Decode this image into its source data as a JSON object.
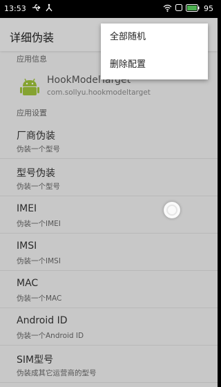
{
  "status_bar": {
    "time": "13:53",
    "battery": "95",
    "icons": [
      "usb-icon",
      "debug-icon",
      "wifi-icon",
      "sim-icon",
      "battery-icon"
    ]
  },
  "app_bar": {
    "title": "详细伪装"
  },
  "sections": {
    "app_info_header": "应用信息",
    "app_settings_header": "应用设置"
  },
  "app_info": {
    "name": "HookModelTarget",
    "package": "com.sollyu.hookmodeltarget",
    "icon": "android-icon"
  },
  "prefs": [
    {
      "title": "厂商伪装",
      "summary": "伪装一个型号"
    },
    {
      "title": "型号伪装",
      "summary": "伪装一个型号"
    },
    {
      "title": "IMEI",
      "summary": "伪装一个IMEI"
    },
    {
      "title": "IMSI",
      "summary": "伪装一个IMSI"
    },
    {
      "title": "MAC",
      "summary": "伪装一个MAC"
    },
    {
      "title": "Android ID",
      "summary": "伪装一个Android ID"
    },
    {
      "title": "SIM型号",
      "summary": "伪装成其它运营商的型号"
    }
  ],
  "menu": {
    "items": [
      "全部随机",
      "删除配置"
    ]
  },
  "colors": {
    "android_green": "#9fc33b",
    "background": "#efefef"
  }
}
